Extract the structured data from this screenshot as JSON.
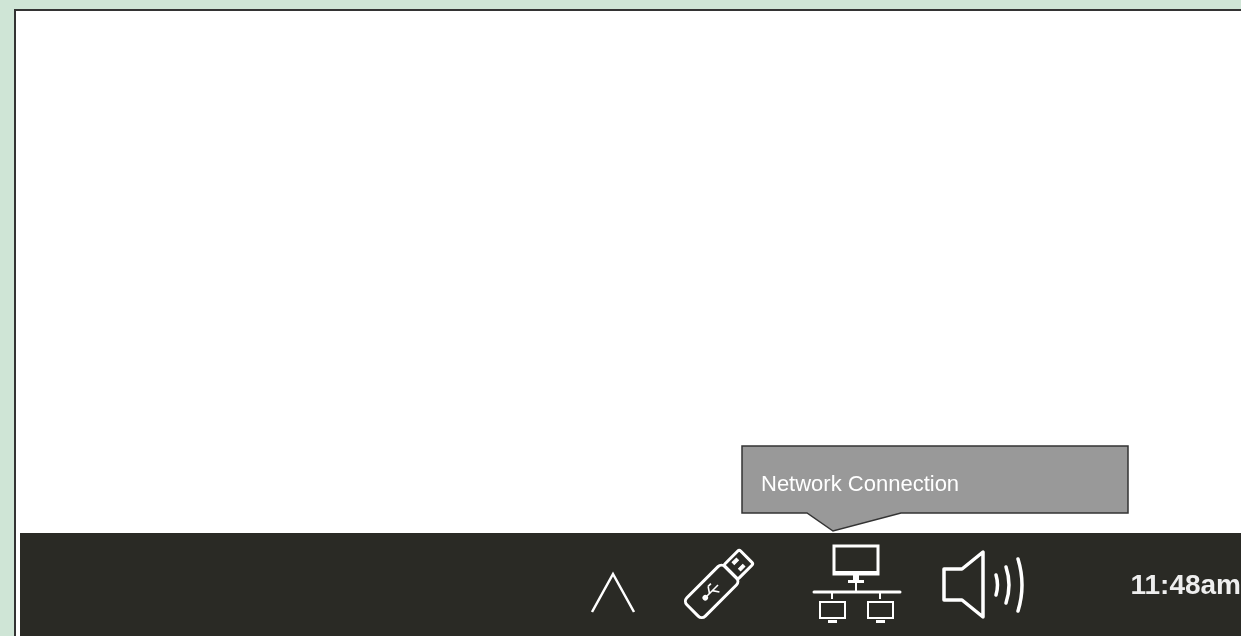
{
  "tooltip": {
    "text": "Network Connection"
  },
  "taskbar": {
    "clock": "11:48am"
  }
}
